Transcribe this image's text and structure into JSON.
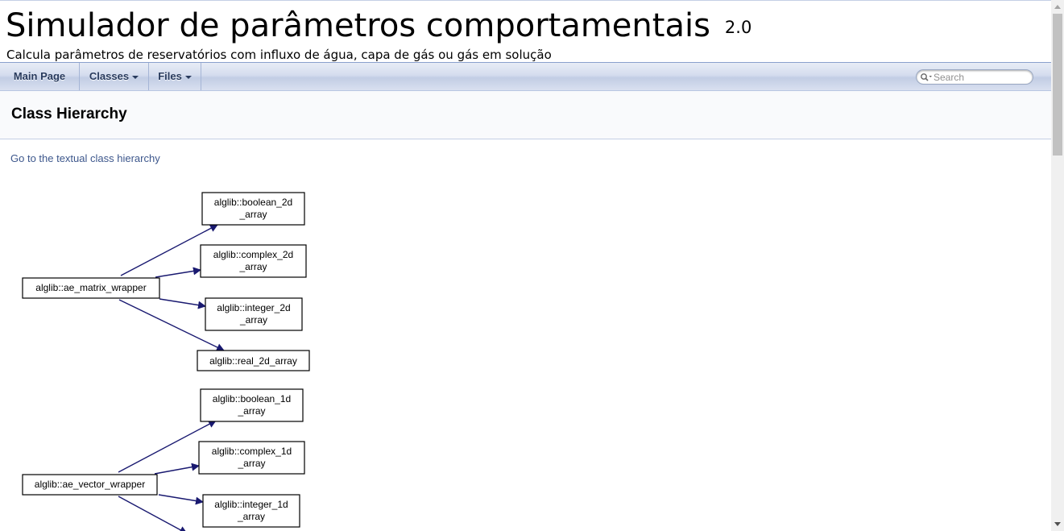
{
  "project": {
    "name": "Simulador de parâmetros comportamentais",
    "number": "2.0",
    "brief": "Calcula parâmetros de reservatórios com influxo de água, capa de gás ou gás em solução"
  },
  "nav": {
    "main_page": "Main Page",
    "classes": "Classes",
    "files": "Files"
  },
  "search": {
    "placeholder": "Search"
  },
  "header": {
    "title": "Class Hierarchy"
  },
  "textual_link": "Go to the textual class hierarchy",
  "graph": {
    "edge_color": "#191970",
    "groups": [
      {
        "base": "alglib::ae_matrix_wrapper",
        "children": [
          [
            "alglib::boolean_2d",
            "_array"
          ],
          [
            "alglib::complex_2d",
            "_array"
          ],
          [
            "alglib::integer_2d",
            "_array"
          ],
          [
            "alglib::real_2d_array"
          ]
        ]
      },
      {
        "base": "alglib::ae_vector_wrapper",
        "children": [
          [
            "alglib::boolean_1d",
            "_array"
          ],
          [
            "alglib::complex_1d",
            "_array"
          ],
          [
            "alglib::integer_1d",
            "_array"
          ]
        ]
      }
    ]
  }
}
